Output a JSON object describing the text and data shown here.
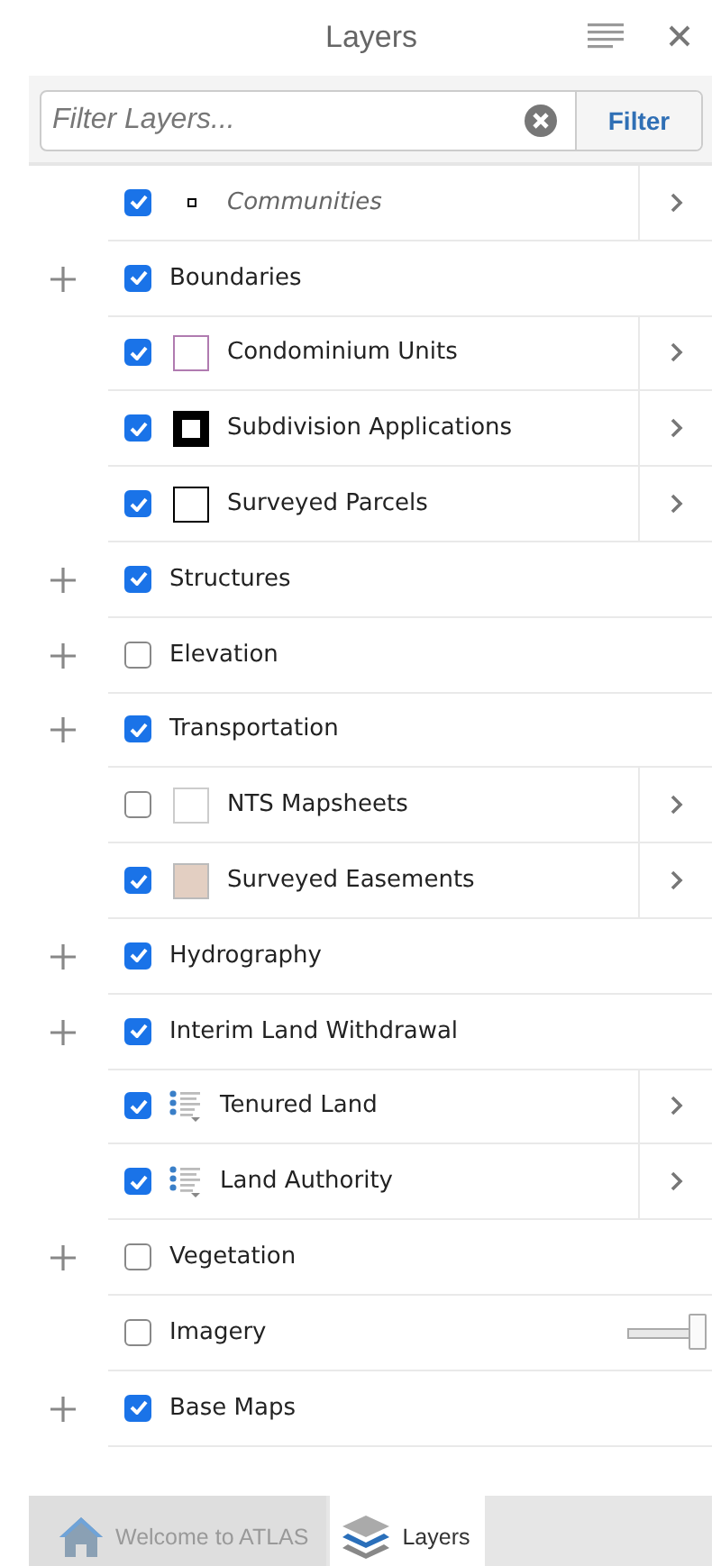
{
  "header": {
    "title": "Layers"
  },
  "filter": {
    "placeholder": "Filter Layers...",
    "button": "Filter"
  },
  "layers": [
    {
      "kind": "layer",
      "name": "Communities",
      "checked": true,
      "out_of_scale": true,
      "symbol": {
        "kind": "dot"
      },
      "has_details": true
    },
    {
      "kind": "group",
      "name": "Boundaries",
      "checked": true,
      "children": [
        {
          "kind": "layer",
          "name": "Condominium Units",
          "checked": true,
          "symbol": {
            "kind": "outline",
            "color": "#b07bb0"
          },
          "has_details": true
        },
        {
          "kind": "layer",
          "name": "Subdivision Applications",
          "checked": true,
          "symbol": {
            "kind": "thick-outline",
            "color": "#000000"
          },
          "has_details": true
        },
        {
          "kind": "layer",
          "name": "Surveyed Parcels",
          "checked": true,
          "symbol": {
            "kind": "outline",
            "color": "#000000"
          },
          "has_details": true
        }
      ]
    },
    {
      "kind": "group",
      "name": "Structures",
      "checked": true
    },
    {
      "kind": "group",
      "name": "Elevation",
      "checked": false
    },
    {
      "kind": "group",
      "name": "Transportation",
      "checked": true,
      "children": [
        {
          "kind": "layer",
          "name": "NTS Mapsheets",
          "checked": false,
          "symbol": {
            "kind": "outline",
            "color": "#cccccc"
          },
          "has_details": true
        },
        {
          "kind": "layer",
          "name": "Surveyed Easements",
          "checked": true,
          "symbol": {
            "kind": "fill",
            "color": "#e3cfc2"
          },
          "has_details": true
        }
      ]
    },
    {
      "kind": "group",
      "name": "Hydrography",
      "checked": true
    },
    {
      "kind": "group",
      "name": "Interim Land Withdrawal",
      "checked": true,
      "children": [
        {
          "kind": "layer",
          "name": "Tenured Land",
          "checked": true,
          "symbol": {
            "kind": "legend"
          },
          "has_details": true
        },
        {
          "kind": "layer",
          "name": "Land Authority",
          "checked": true,
          "symbol": {
            "kind": "legend"
          },
          "has_details": true
        }
      ]
    },
    {
      "kind": "group",
      "name": "Vegetation",
      "checked": false
    },
    {
      "kind": "basemap",
      "name": "Imagery",
      "checked": false,
      "level": 1
    },
    {
      "kind": "group",
      "name": "Base Maps",
      "checked": true
    }
  ],
  "tabs": [
    {
      "label": "Welcome to ATLAS",
      "selected": false
    },
    {
      "label": "Layers",
      "selected": true
    }
  ]
}
